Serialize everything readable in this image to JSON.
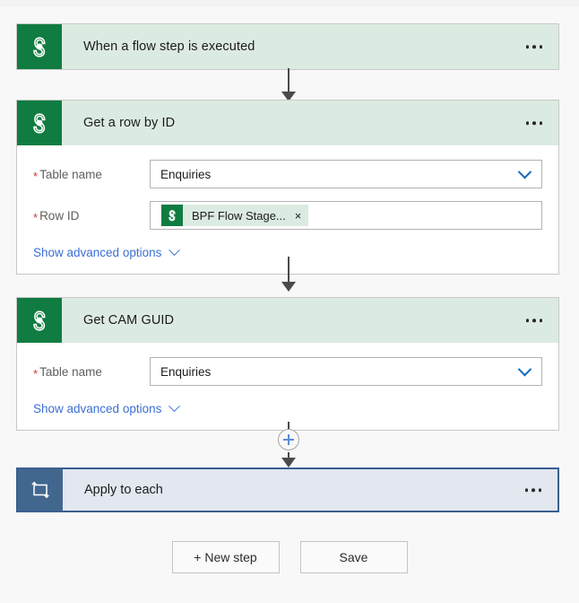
{
  "flow": {
    "steps": [
      {
        "id": "trigger",
        "title": "When a flow step is executed",
        "icon": "dataverse-icon",
        "type": "trigger",
        "menu_label": "…",
        "fields": []
      },
      {
        "id": "get-row-by-id",
        "title": "Get a row by ID",
        "icon": "dataverse-icon",
        "type": "action",
        "menu_label": "…",
        "fields": [
          {
            "label": "Table name",
            "required": true,
            "control": "dropdown",
            "value": "Enquiries",
            "chevron": "chevron-down-icon"
          },
          {
            "label": "Row ID",
            "required": true,
            "control": "token",
            "token_text": "BPF Flow Stage...",
            "token_icon": "dataverse-icon",
            "token_remove": "×"
          }
        ],
        "advanced_label": "Show advanced options"
      },
      {
        "id": "get-cam-guid",
        "title": "Get CAM GUID",
        "icon": "dataverse-icon",
        "type": "action",
        "menu_label": "…",
        "fields": [
          {
            "label": "Table name",
            "required": true,
            "control": "dropdown",
            "value": "Enquiries",
            "chevron": "chevron-down-icon"
          }
        ],
        "advanced_label": "Show advanced options"
      },
      {
        "id": "apply-to-each",
        "title": "Apply to each",
        "icon": "loop-icon",
        "type": "control",
        "menu_label": "…",
        "fields": []
      }
    ],
    "insert_button": {
      "label": "+",
      "name": "insert-step-button"
    }
  },
  "footer": {
    "new_step_label": "+ New step",
    "save_label": "Save"
  },
  "colors": {
    "trigger_header": "#dcebe1",
    "connector_green": "#107c41",
    "loop_border": "#3a5f8f",
    "loop_body": "#e2e7f0",
    "loop_icon_bg": "#42678f",
    "accent_link": "#3b6fd4",
    "required_marker": "#d13438",
    "canvas_bg": "#f8f8f8"
  }
}
